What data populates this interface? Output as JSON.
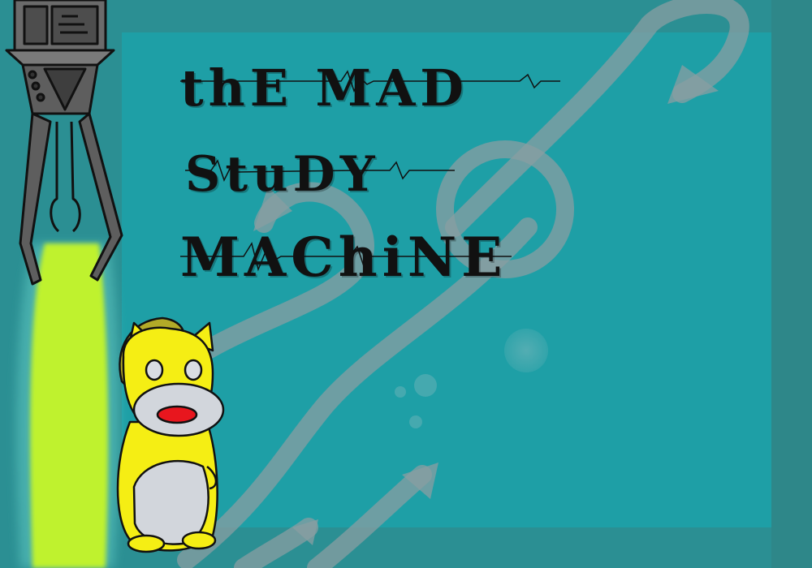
{
  "title": {
    "line1": "thE MAD",
    "line2": "StuDY",
    "line3": "MAChiNE"
  },
  "colors": {
    "background": "#1e9fa6",
    "frame": "#2b8f93",
    "arrow": "#8a9ea2",
    "mascot_body": "#f5ee14",
    "mascot_belly": "#d2d6dc",
    "mascot_mouth": "#e8161e",
    "slime": "#bff22e",
    "claw_metal": "#6d6d6d"
  },
  "icons": [
    "robot-claw-icon",
    "yellow-creature-icon",
    "curved-arrow-icon",
    "bubble-icon"
  ]
}
